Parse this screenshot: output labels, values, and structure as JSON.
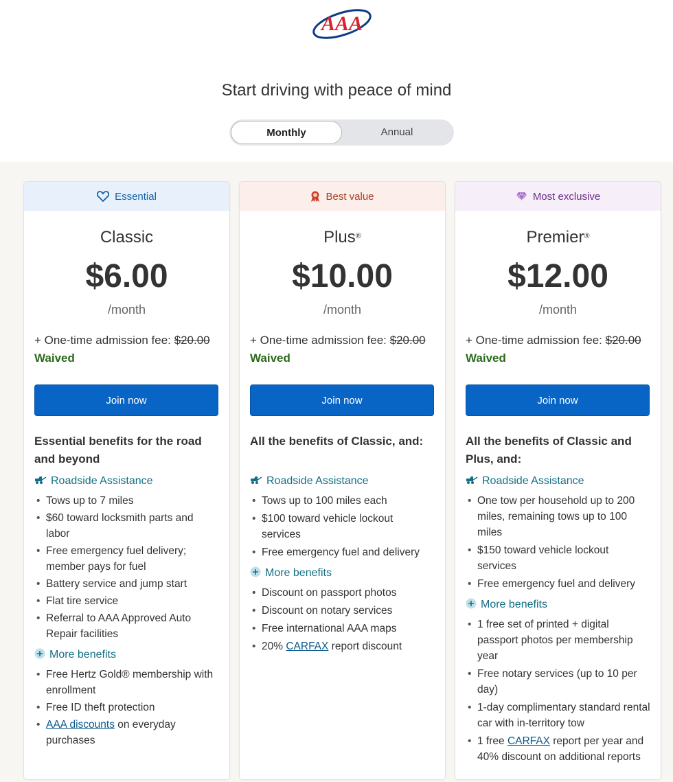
{
  "header": {
    "logo_text": "AAA",
    "headline": "Start driving with peace of mind",
    "toggle": {
      "monthly": "Monthly",
      "annual": "Annual",
      "selected": "Monthly"
    }
  },
  "plans": [
    {
      "badge": "Essential",
      "badge_icon": "heart-icon",
      "name": "Classic",
      "reg": "",
      "price": "$6.00",
      "period": "/month",
      "fee_label": "+ One-time admission fee:",
      "fee_amount": "$20.00",
      "waived": "Waived",
      "cta": "Join now",
      "intro": "Essential benefits for the road and beyond",
      "roadside_title": "Roadside Assistance",
      "roadside": [
        "Tows up to 7 miles",
        "$60 toward locksmith parts and labor",
        "Free emergency fuel delivery; member pays for fuel",
        "Battery service and jump start",
        "Flat tire service",
        "Referral to AAA Approved Auto Repair facilities"
      ],
      "more_title": "More benefits",
      "more": [
        {
          "pre": "",
          "link": "",
          "text": "Free Hertz Gold® membership with enrollment"
        },
        {
          "pre": "",
          "link": "",
          "text": "Free ID theft protection"
        },
        {
          "pre": "",
          "link": "AAA discounts",
          "text": " on everyday purchases"
        }
      ]
    },
    {
      "badge": "Best value",
      "badge_icon": "ribbon-icon",
      "name": "Plus",
      "reg": "®",
      "price": "$10.00",
      "period": "/month",
      "fee_label": "+ One-time admission fee:",
      "fee_amount": "$20.00",
      "waived": "Waived",
      "cta": "Join now",
      "intro": "All the benefits of Classic, and:",
      "roadside_title": "Roadside Assistance",
      "roadside": [
        "Tows up to 100 miles each",
        "$100 toward vehicle lockout services",
        "Free emergency fuel and delivery"
      ],
      "more_title": "More benefits",
      "more": [
        {
          "pre": "",
          "link": "",
          "text": "Discount on passport photos"
        },
        {
          "pre": "",
          "link": "",
          "text": "Discount on notary services"
        },
        {
          "pre": "",
          "link": "",
          "text": "Free international AAA maps"
        },
        {
          "pre": "20% ",
          "link": "CARFAX",
          "text": " report discount"
        }
      ]
    },
    {
      "badge": "Most exclusive",
      "badge_icon": "gem-icon",
      "name": "Premier",
      "reg": "®",
      "price": "$12.00",
      "period": "/month",
      "fee_label": "+ One-time admission fee:",
      "fee_amount": "$20.00",
      "waived": "Waived",
      "cta": "Join now",
      "intro": "All the benefits of Classic and Plus, and:",
      "roadside_title": "Roadside Assistance",
      "roadside": [
        "One tow per household up to 200 miles, remaining tows up to 100 miles",
        "$150 toward vehicle lockout services",
        "Free emergency fuel and delivery"
      ],
      "more_title": "More benefits",
      "more": [
        {
          "pre": "",
          "link": "",
          "text": "1 free set of printed + digital passport photos per membership year"
        },
        {
          "pre": "",
          "link": "",
          "text": "Free notary services (up to 10 per day)"
        },
        {
          "pre": "",
          "link": "",
          "text": "1-day complimentary standard rental car with in-territory tow"
        },
        {
          "pre": "1 free ",
          "link": "CARFAX",
          "text": " report per year and 40% discount on additional reports"
        }
      ]
    }
  ],
  "colors": {
    "primary_button": "#0864c5",
    "waived": "#2b6a1b",
    "section_title": "#136f86",
    "logo_red": "#d6232d",
    "logo_blue": "#0a3b86"
  }
}
